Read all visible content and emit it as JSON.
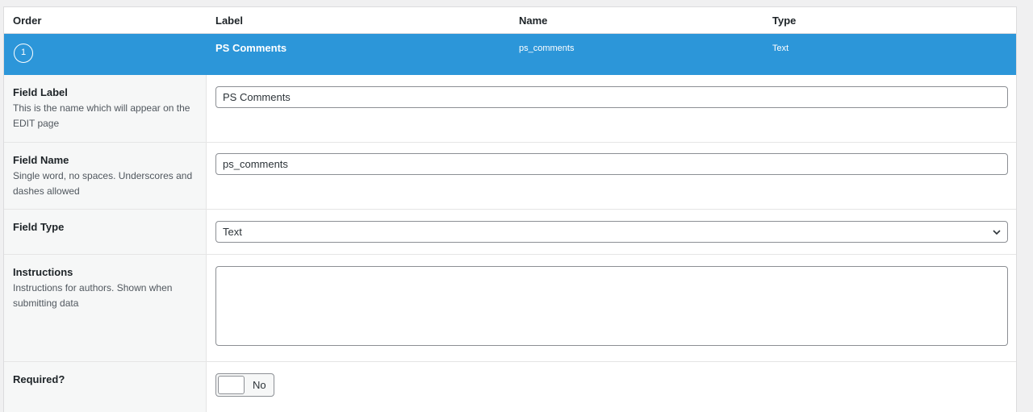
{
  "columns": {
    "order": "Order",
    "label": "Label",
    "name": "Name",
    "type": "Type"
  },
  "selected_field": {
    "order": "1",
    "label": "PS Comments",
    "name": "ps_comments",
    "type": "Text"
  },
  "settings": {
    "field_label": {
      "title": "Field Label",
      "description": "This is the name which will appear on the EDIT page",
      "value": "PS Comments"
    },
    "field_name": {
      "title": "Field Name",
      "description": "Single word, no spaces. Underscores and dashes allowed",
      "value": "ps_comments"
    },
    "field_type": {
      "title": "Field Type",
      "value": "Text"
    },
    "instructions": {
      "title": "Instructions",
      "description": "Instructions for authors. Shown when submitting data",
      "value": ""
    },
    "required": {
      "title": "Required?",
      "toggle_label": "No",
      "enabled": false
    }
  },
  "colors": {
    "selected_row": "#2c96d9",
    "label_column_bg": "#f6f7f7"
  }
}
